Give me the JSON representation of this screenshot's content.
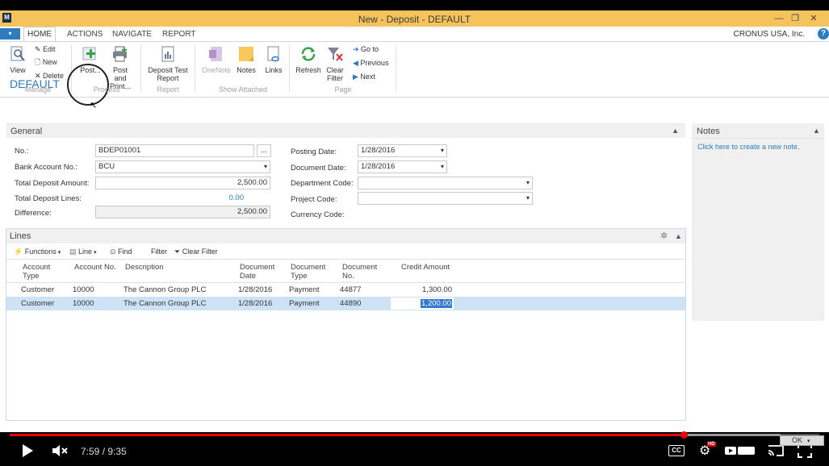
{
  "window": {
    "title": "New - Deposit - DEFAULT",
    "app_logo": "M"
  },
  "menu": {
    "file_label": "▾",
    "tabs": [
      "HOME",
      "ACTIONS",
      "NAVIGATE",
      "REPORT"
    ],
    "company": "CRONUS USA, Inc.",
    "help": "?"
  },
  "ribbon": {
    "manage": {
      "view": "View",
      "edit": "Edit",
      "new": "New",
      "delete": "Delete",
      "group": "Manage"
    },
    "process": {
      "post": "Post...",
      "post_print_1": "Post and",
      "post_print_2": "Print...",
      "group": "Process"
    },
    "report": {
      "deposit_test_1": "Deposit Test",
      "deposit_test_2": "Report",
      "group": "Report"
    },
    "show_attached": {
      "onenote": "OneNote",
      "notes": "Notes",
      "links": "Links",
      "group": "Show Attached"
    },
    "page": {
      "refresh": "Refresh",
      "clear_filter_1": "Clear",
      "clear_filter_2": "Filter",
      "go_to": "Go to",
      "previous": "Previous",
      "next": "Next",
      "group": "Page"
    }
  },
  "page_title": "DEFAULT",
  "general": {
    "header": "General",
    "no_label": "No.:",
    "no_value": "BDEP01001",
    "assist": "...",
    "bank_label": "Bank Account No.:",
    "bank_value": "BCU",
    "total_amount_label": "Total Deposit Amount:",
    "total_amount_value": "2,500.00",
    "total_lines_label": "Total Deposit Lines:",
    "total_lines_value": "0.00",
    "difference_label": "Difference:",
    "difference_value": "2,500.00",
    "posting_date_label": "Posting Date:",
    "posting_date_value": "1/28/2016",
    "document_date_label": "Document Date:",
    "document_date_value": "1/28/2016",
    "department_label": "Department Code:",
    "department_value": "",
    "project_label": "Project Code:",
    "project_value": "",
    "currency_label": "Currency Code:"
  },
  "notes": {
    "header": "Notes",
    "link": "Click here to create a new note."
  },
  "lines": {
    "header": "Lines",
    "toolbar": {
      "functions": "Functions",
      "line": "Line",
      "find": "Find",
      "filter": "Filter",
      "clear_filter": "Clear Filter"
    },
    "columns": [
      {
        "l1": "Account",
        "l2": "Type"
      },
      {
        "l1": "Account No.",
        "l2": ""
      },
      {
        "l1": "Description",
        "l2": ""
      },
      {
        "l1": "Document",
        "l2": "Date"
      },
      {
        "l1": "Document",
        "l2": "Type"
      },
      {
        "l1": "Document",
        "l2": "No."
      },
      {
        "l1": "Credit Amount",
        "l2": ""
      }
    ],
    "rows": [
      {
        "account_type": "Customer",
        "account_no": "10000",
        "description": "The Cannon Group PLC",
        "doc_date": "1/28/2016",
        "doc_type": "Payment",
        "doc_no": "44877",
        "credit_amount": "1,300.00"
      },
      {
        "account_type": "Customer",
        "account_no": "10000",
        "description": "The Cannon Group PLC",
        "doc_date": "1/28/2016",
        "doc_type": "Payment",
        "doc_no": "44890",
        "credit_amount": "1,200.00"
      }
    ]
  },
  "player": {
    "time": "7:59 / 9:35",
    "progress": 0.833,
    "quality": "HD",
    "ok": "OK"
  },
  "colors": {
    "title_bar": "#f5c35c",
    "accent": "#2d7cc1",
    "selected_row": "#cde3f5",
    "played": "#e00000"
  }
}
